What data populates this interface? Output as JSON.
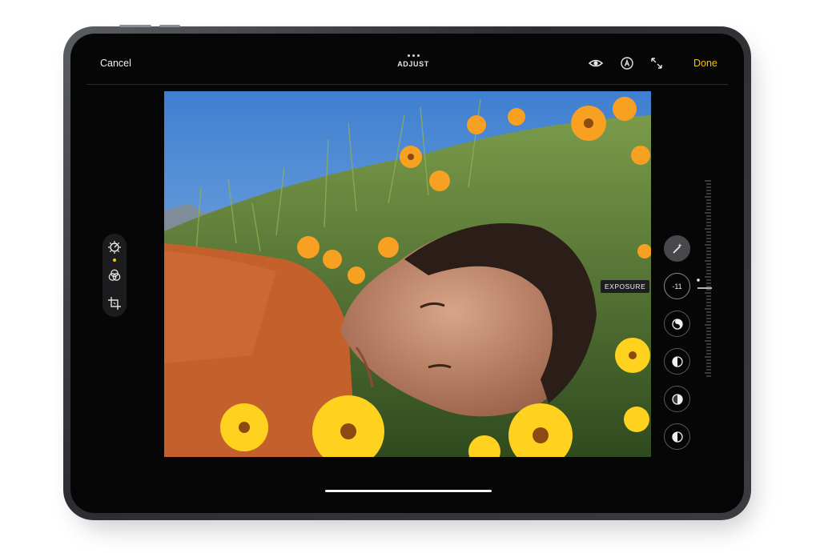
{
  "toolbar": {
    "cancel_label": "Cancel",
    "title": "ADJUST",
    "done_label": "Done",
    "done_color": "#f6c500",
    "icons": [
      "eye-icon",
      "markup-pen-icon",
      "expand-arrows-icon"
    ]
  },
  "side_tools": {
    "items": [
      {
        "icon": "adjust-dial-icon",
        "selected": true
      },
      {
        "icon": "filters-icon",
        "selected": false
      },
      {
        "icon": "crop-icon",
        "selected": false
      }
    ],
    "selected_indicator_color": "#f5c400"
  },
  "adjustments": {
    "auto_enhance_icon": "magic-wand-icon",
    "active": {
      "label": "EXPOSURE",
      "value": "-11"
    },
    "other_icons": [
      "brilliance-icon",
      "highlights-icon",
      "shadows-icon",
      "contrast-icon"
    ]
  },
  "slider": {
    "value": -11
  }
}
